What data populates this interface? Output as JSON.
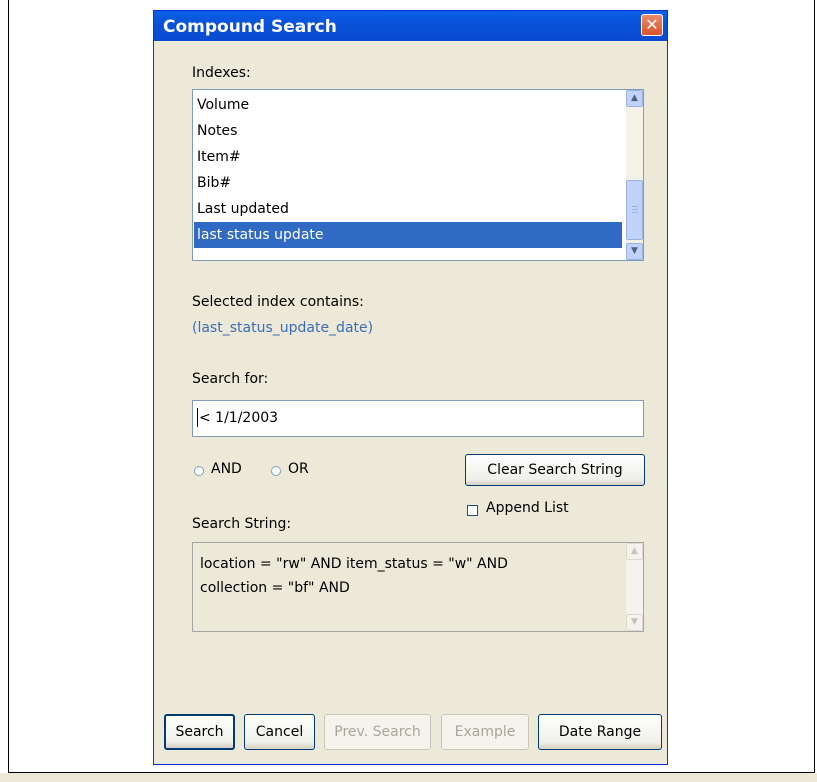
{
  "dialog": {
    "title": "Compound Search",
    "close_glyph": "✕"
  },
  "indexes": {
    "label": "Indexes:",
    "items": [
      "Volume",
      "Notes",
      "Item#",
      "Bib#",
      "Last updated",
      "last status update"
    ],
    "selected": "last status update"
  },
  "selected_index": {
    "label": "Selected index contains:",
    "value": "(last_status_update_date)"
  },
  "search_for": {
    "label": "Search for:",
    "value": "< 1/1/2003"
  },
  "operators": {
    "and_label": "AND",
    "or_label": "OR"
  },
  "clear_button": "Clear Search String",
  "append_list": {
    "label": "Append List",
    "checked": false
  },
  "search_string": {
    "label": "Search String:",
    "lines": [
      "location = \"rw\" AND item_status = \"w\" AND",
      "collection = \"bf\" AND"
    ]
  },
  "buttons": {
    "search": "Search",
    "cancel": "Cancel",
    "prev_search": "Prev. Search",
    "example": "Example",
    "date_range": "Date Range"
  },
  "colors": {
    "title_bar": "#0a5fe6",
    "selection": "#316ac5",
    "link_text": "#3a6cb8",
    "dialog_bg": "#ece9d8"
  },
  "icons": {
    "close": "close-icon",
    "scroll_up": "chevron-up-icon",
    "scroll_down": "chevron-down-icon"
  }
}
